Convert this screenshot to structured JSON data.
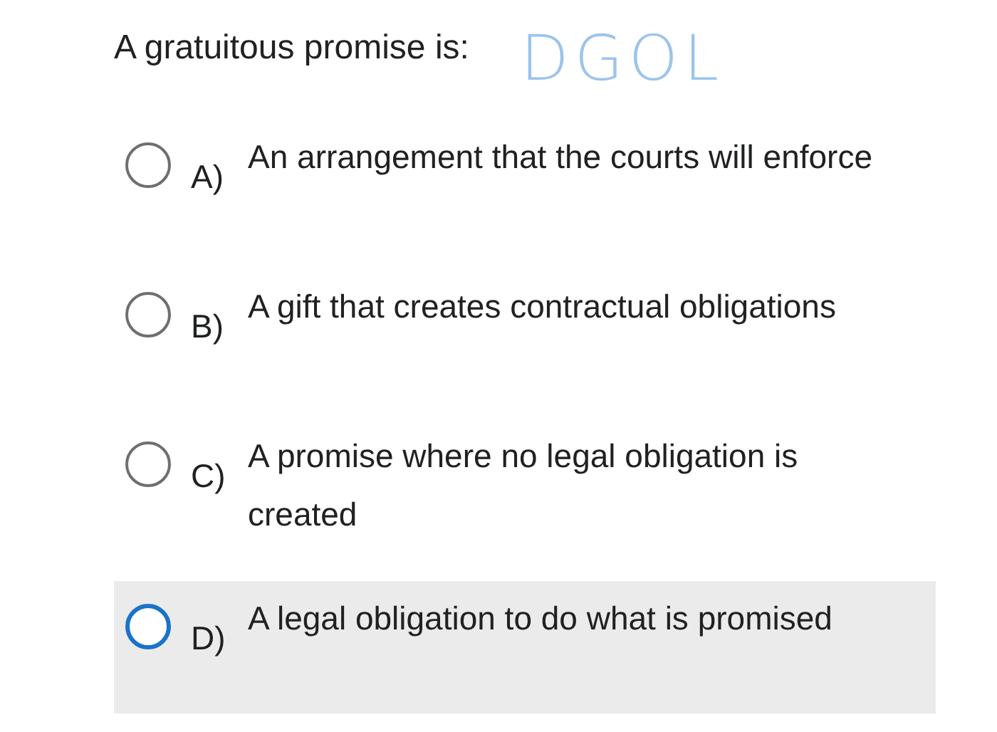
{
  "question": "A gratuitous promise is:",
  "annotation": "DGOL",
  "options": [
    {
      "letter": "A)",
      "text": "An arrangement that the courts will enforce",
      "focused": false
    },
    {
      "letter": "B)",
      "text": "A gift that creates contractual obligations",
      "focused": false
    },
    {
      "letter": "C)",
      "text": "A promise where no legal obligation is created",
      "focused": false
    },
    {
      "letter": "D)",
      "text": "A legal obligation to do what is promised",
      "focused": true
    }
  ]
}
